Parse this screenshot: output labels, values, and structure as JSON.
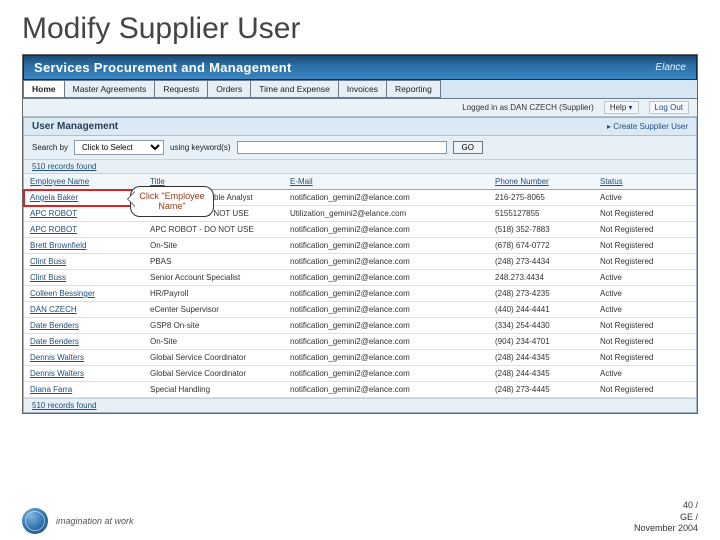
{
  "slide": {
    "title": "Modify Supplier User"
  },
  "brand": {
    "app": "Services Procurement and Management",
    "vendor": "Elance"
  },
  "tabs": [
    "Home",
    "Master Agreements",
    "Requests",
    "Orders",
    "Time and Expense",
    "Invoices",
    "Reporting"
  ],
  "active_tab": 0,
  "util": {
    "logged_in_as": "Logged in as DAN CZECH (Supplier)",
    "help": "Help",
    "logout": "Log Out"
  },
  "panel": {
    "title": "User Management",
    "create_link": "Create Supplier User"
  },
  "search": {
    "label": "Search by",
    "select_placeholder": "Click to Select",
    "keywords_label": "using keyword(s)",
    "go": "GO"
  },
  "records": {
    "label": "510 records found"
  },
  "columns": [
    "Employee Name",
    "Title",
    "E-Mail",
    "Phone Number",
    "Status"
  ],
  "rows": [
    {
      "name": "Angela Baker",
      "title": "Accounts Receivable Analyst",
      "email": "notification_gemini2@elance.com",
      "phone": "216-275-8065",
      "status": "Active"
    },
    {
      "name": "APC ROBOT",
      "title": "APC ROBOT DO NOT USE",
      "email": "Utilization_gemini2@elance.com",
      "phone": "5155127855",
      "status": "Not Registered"
    },
    {
      "name": "APC ROBOT",
      "title": "APC ROBOT - DO NOT USE",
      "email": "notification_gemini2@elance.com",
      "phone": "(518) 352-7883",
      "status": "Not Registered"
    },
    {
      "name": "Brett Brownfield",
      "title": "On-Site",
      "email": "notification_gemini2@elance.com",
      "phone": "(678) 674-0772",
      "status": "Not Registered"
    },
    {
      "name": "Clint Buss",
      "title": "PBAS",
      "email": "notification_gemini2@elance.com",
      "phone": "(248) 273-4434",
      "status": "Not Registered"
    },
    {
      "name": "Clint Buss",
      "title": "Senior Account Specialist",
      "email": "notification_gemini2@elance.com",
      "phone": "248.273.4434",
      "status": "Active"
    },
    {
      "name": "Colleen Bessinger",
      "title": "HR/Payroll",
      "email": "notification_gemini2@elance.com",
      "phone": "(248) 273-4235",
      "status": "Active"
    },
    {
      "name": "DAN CZECH",
      "title": "eCenter Supervisor",
      "email": "notification_gemini2@elance.com",
      "phone": "(440) 244-4441",
      "status": "Active"
    },
    {
      "name": "Date Benders",
      "title": "GSP8 On-site",
      "email": "notification_gemini2@elance.com",
      "phone": "(334) 254-4430",
      "status": "Not Registered"
    },
    {
      "name": "Date Benders",
      "title": "On-Site",
      "email": "notification_gemini2@elance.com",
      "phone": "(904) 234-4701",
      "status": "Not Registered"
    },
    {
      "name": "Dennis Walters",
      "title": "Global Service Coordinator",
      "email": "notification_gemini2@elance.com",
      "phone": "(248) 244-4345",
      "status": "Not Registered"
    },
    {
      "name": "Dennis Walters",
      "title": "Global Service Coordinator",
      "email": "notification_gemini2@elance.com",
      "phone": "(248) 244-4345",
      "status": "Active"
    },
    {
      "name": "Diana Farra",
      "title": "Special Handling",
      "email": "notification_gemini2@elance.com",
      "phone": "(248) 273-4445",
      "status": "Not Registered"
    }
  ],
  "callout": {
    "text": "Click \"Employee Name\""
  },
  "footer": {
    "tagline": "imagination at work",
    "page": "40 /",
    "org": "GE /",
    "date": "November 2004"
  }
}
